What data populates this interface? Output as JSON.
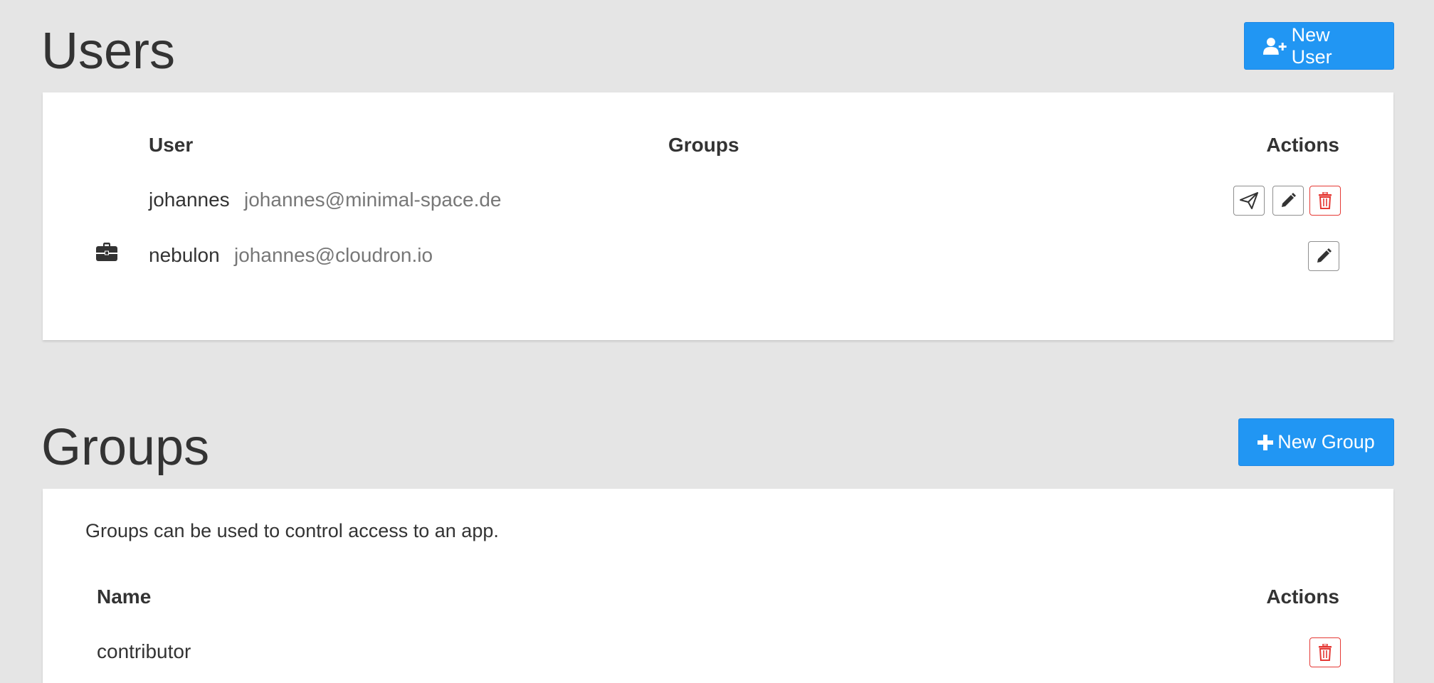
{
  "users_section": {
    "title": "Users",
    "new_user_label": "New User",
    "table": {
      "headers": {
        "user": "User",
        "groups": "Groups",
        "actions": "Actions"
      },
      "rows": [
        {
          "username": "johannes",
          "email": "johannes@minimal-space.de",
          "badge_icon": "",
          "actions": [
            "send-invite-icon",
            "edit-icon",
            "delete-icon"
          ]
        },
        {
          "username": "nebulon",
          "email": "johannes@cloudron.io",
          "badge_icon": "briefcase-icon",
          "actions": [
            "edit-icon"
          ]
        }
      ]
    }
  },
  "groups_section": {
    "title": "Groups",
    "new_group_label": "New Group",
    "description": "Groups can be used to control access to an app.",
    "table": {
      "headers": {
        "name": "Name",
        "actions": "Actions"
      },
      "rows": [
        {
          "name": "contributor",
          "actions": [
            "delete-icon"
          ]
        }
      ]
    }
  },
  "colors": {
    "primary": "#2196f3",
    "danger": "#e53935",
    "background": "#e5e5e5"
  }
}
